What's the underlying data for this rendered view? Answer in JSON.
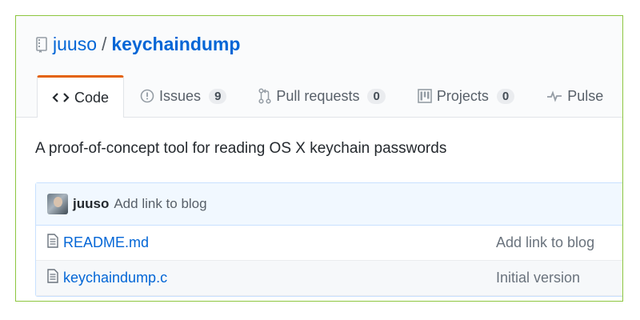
{
  "repo": {
    "owner": "juuso",
    "separator": "/",
    "name": "keychaindump",
    "description": "A proof-of-concept tool for reading OS X keychain passwords"
  },
  "tabs": [
    {
      "label": "Code",
      "icon": "code-icon",
      "selected": true
    },
    {
      "label": "Issues",
      "icon": "issue-icon",
      "count": "9"
    },
    {
      "label": "Pull requests",
      "icon": "pull-request-icon",
      "count": "0"
    },
    {
      "label": "Projects",
      "icon": "project-icon",
      "count": "0"
    },
    {
      "label": "Pulse",
      "icon": "pulse-icon"
    }
  ],
  "latest_commit": {
    "author": "juuso",
    "message": "Add link to blog"
  },
  "files": [
    {
      "name": "README.md",
      "commit": "Add link to blog",
      "icon": "file-icon"
    },
    {
      "name": "keychaindump.c",
      "commit": "Initial version",
      "icon": "file-icon"
    }
  ],
  "colors": {
    "link": "#0366d6",
    "selected_tab_accent": "#e36209",
    "frame_border": "#8dc63f",
    "commit_bg": "#f1f8ff"
  }
}
